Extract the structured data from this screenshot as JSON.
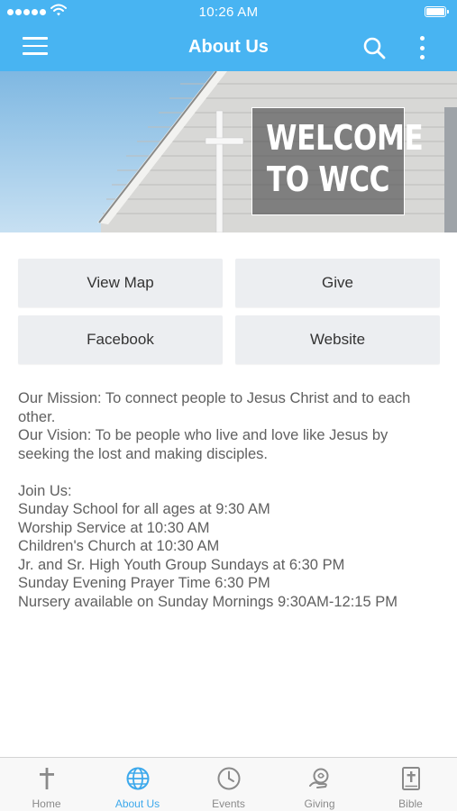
{
  "status_bar": {
    "time": "10:26 AM"
  },
  "header": {
    "title": "About Us",
    "icons": [
      "menu-icon",
      "search-icon",
      "more-vertical-icon"
    ]
  },
  "banner": {
    "sign_line1": "WELCOME",
    "sign_line2": "TO WCC"
  },
  "buttons": {
    "view_map": "View Map",
    "give": "Give",
    "facebook": "Facebook",
    "website": "Website"
  },
  "content": {
    "mission": "Our Mission:  To connect people to Jesus Christ and to each other.",
    "vision": "Our Vision: To be people who live and love like Jesus by seeking the lost and making disciples.",
    "join_heading": "Join Us:",
    "schedule": [
      "Sunday School for all ages at 9:30 AM",
      "Worship Service at 10:30 AM",
      "Children's Church at 10:30 AM",
      "Jr. and Sr. High Youth Group Sundays at 6:30 PM",
      "Sunday Evening Prayer Time 6:30 PM",
      "Nursery available on Sunday Mornings 9:30AM-12:15 PM"
    ]
  },
  "tabbar": {
    "tabs": [
      {
        "label": "Home",
        "icon": "cross-icon"
      },
      {
        "label": "About Us",
        "icon": "globe-icon",
        "active": true
      },
      {
        "label": "Events",
        "icon": "clock-icon"
      },
      {
        "label": "Giving",
        "icon": "giving-hand-icon"
      },
      {
        "label": "Bible",
        "icon": "bible-icon"
      }
    ]
  },
  "colors": {
    "accent": "#48b4f2",
    "active_tab": "#3da9ec",
    "button_bg": "#eceef1"
  }
}
